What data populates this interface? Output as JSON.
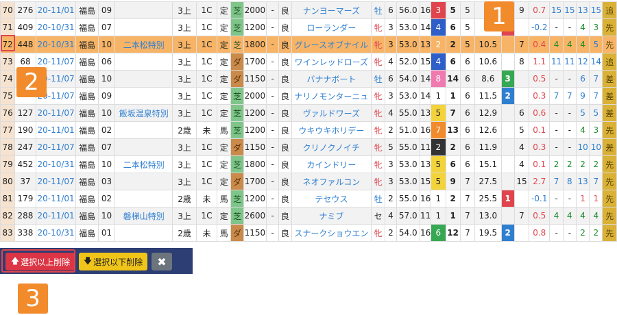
{
  "rows": [
    {
      "idx": "70",
      "id": "276",
      "date": "20-11/01",
      "venue": "福島",
      "vnum": "09",
      "race": "",
      "cls": "3上",
      "grade": "1C",
      "kind": "定",
      "surf": "芝",
      "dist": "2000",
      "dash": "-",
      "cond": "良",
      "horse": "ナンヨーマーズ",
      "sex": "牡",
      "age": "6",
      "wt": "56.0",
      "n": "16",
      "gate": "3",
      "pos": "5",
      "pop": "5",
      "odds": "",
      "rank": "",
      "rt": "9",
      "diff": "0.7",
      "c1": "15",
      "c2": "15",
      "c3": "13",
      "c4": "15",
      "style": "追"
    },
    {
      "idx": "71",
      "id": "409",
      "date": "20-10/31",
      "venue": "福島",
      "vnum": "07",
      "race": "",
      "cls": "3上",
      "grade": "1C",
      "kind": "定",
      "surf": "芝",
      "dist": "1200",
      "dash": "-",
      "cond": "良",
      "horse": "ローランダー",
      "sex": "牝",
      "age": "3",
      "wt": "53.0",
      "n": "14",
      "gate": "4",
      "pos": "6",
      "pop": "5",
      "odds": "",
      "rank": "1",
      "rt": "",
      "diff": "-0.2",
      "c1": "-",
      "c2": "-",
      "c3": "4",
      "c4": "3",
      "style": "先"
    },
    {
      "idx": "72",
      "id": "448",
      "date": "20-10/31",
      "venue": "福島",
      "vnum": "10",
      "race": "二本松特別",
      "cls": "3上",
      "grade": "1C",
      "kind": "定",
      "surf": "芝",
      "dist": "1800",
      "dash": "-",
      "cond": "良",
      "horse": "グレースオブナイル",
      "sex": "牝",
      "age": "3",
      "wt": "53.0",
      "n": "13",
      "gate": "2",
      "pos": "2",
      "pop": "5",
      "odds": "10.5",
      "rank": "",
      "rt": "7",
      "diff": "0.4",
      "c1": "4",
      "c2": "4",
      "c3": "4",
      "c4": "5",
      "style": "先"
    },
    {
      "idx": "73",
      "id": "68",
      "date": "20-11/07",
      "venue": "福島",
      "vnum": "06",
      "race": "",
      "cls": "3上",
      "grade": "1C",
      "kind": "定",
      "surf": "ダ",
      "dist": "1700",
      "dash": "-",
      "cond": "良",
      "horse": "ワインレッドローズ",
      "sex": "牝",
      "age": "4",
      "wt": "52.0",
      "n": "15",
      "gate": "4",
      "pos": "6",
      "pop": "6",
      "odds": "10.6",
      "rank": "",
      "rt": "8",
      "diff": "1.1",
      "c1": "11",
      "c2": "11",
      "c3": "12",
      "c4": "14",
      "style": "追"
    },
    {
      "idx": "74",
      "id": "",
      "date": "20-11/07",
      "venue": "福島",
      "vnum": "10",
      "race": "",
      "cls": "3上",
      "grade": "1C",
      "kind": "定",
      "surf": "ダ",
      "dist": "1150",
      "dash": "-",
      "cond": "良",
      "horse": "バナナボート",
      "sex": "牡",
      "age": "6",
      "wt": "54.0",
      "n": "14",
      "gate": "8",
      "pos": "14",
      "pop": "6",
      "odds": "8.6",
      "rank": "3",
      "rt": "",
      "diff": "0.5",
      "c1": "-",
      "c2": "-",
      "c3": "6",
      "c4": "7",
      "style": "差"
    },
    {
      "idx": "75",
      "id": "",
      "date": "20-11/07",
      "venue": "福島",
      "vnum": "09",
      "race": "",
      "cls": "3上",
      "grade": "1C",
      "kind": "定",
      "surf": "芝",
      "dist": "2000",
      "dash": "-",
      "cond": "良",
      "horse": "ナリノモンターニュ",
      "sex": "牝",
      "age": "3",
      "wt": "53.0",
      "n": "14",
      "gate": "1",
      "pos": "1",
      "pop": "6",
      "odds": "11.5",
      "rank": "2",
      "rt": "",
      "diff": "0.3",
      "c1": "7",
      "c2": "7",
      "c3": "9",
      "c4": "7",
      "style": "差"
    },
    {
      "idx": "76",
      "id": "127",
      "date": "20-11/07",
      "venue": "福島",
      "vnum": "10",
      "race": "飯坂温泉特別",
      "cls": "3上",
      "grade": "1C",
      "kind": "定",
      "surf": "芝",
      "dist": "1200",
      "dash": "-",
      "cond": "良",
      "horse": "ヴァルドワーズ",
      "sex": "牝",
      "age": "4",
      "wt": "55.0",
      "n": "13",
      "gate": "5",
      "pos": "7",
      "pop": "6",
      "odds": "12.9",
      "rank": "",
      "rt": "6",
      "diff": "0.6",
      "c1": "-",
      "c2": "-",
      "c3": "5",
      "c4": "5",
      "style": "差"
    },
    {
      "idx": "77",
      "id": "190",
      "date": "20-11/01",
      "venue": "福島",
      "vnum": "02",
      "race": "",
      "cls": "2歳",
      "grade": "未",
      "kind": "馬",
      "surf": "芝",
      "dist": "1200",
      "dash": "-",
      "cond": "良",
      "horse": "ウキウキホリデー",
      "sex": "牝",
      "age": "2",
      "wt": "51.0",
      "n": "16",
      "gate": "7",
      "pos": "13",
      "pop": "6",
      "odds": "12.6",
      "rank": "",
      "rt": "5",
      "diff": "0.1",
      "c1": "-",
      "c2": "-",
      "c3": "4",
      "c4": "3",
      "style": "先"
    },
    {
      "idx": "78",
      "id": "247",
      "date": "20-11/07",
      "venue": "福島",
      "vnum": "07",
      "race": "",
      "cls": "3上",
      "grade": "1C",
      "kind": "定",
      "surf": "ダ",
      "dist": "1150",
      "dash": "-",
      "cond": "良",
      "horse": "クリノクノイチ",
      "sex": "牝",
      "age": "5",
      "wt": "55.0",
      "n": "11",
      "gate": "2",
      "pos": "2",
      "pop": "6",
      "odds": "11.9",
      "rank": "",
      "rt": "4",
      "diff": "0.3",
      "c1": "-",
      "c2": "-",
      "c3": "10",
      "c4": "10",
      "style": "差"
    },
    {
      "idx": "79",
      "id": "452",
      "date": "20-10/31",
      "venue": "福島",
      "vnum": "10",
      "race": "二本松特別",
      "cls": "3上",
      "grade": "1C",
      "kind": "定",
      "surf": "芝",
      "dist": "1800",
      "dash": "-",
      "cond": "良",
      "horse": "カインドリー",
      "sex": "牝",
      "age": "3",
      "wt": "53.0",
      "n": "13",
      "gate": "5",
      "pos": "6",
      "pop": "6",
      "odds": "15.1",
      "rank": "",
      "rt": "4",
      "diff": "0.1",
      "c1": "2",
      "c2": "2",
      "c3": "2",
      "c4": "2",
      "style": "先"
    },
    {
      "idx": "80",
      "id": "37",
      "date": "20-11/07",
      "venue": "福島",
      "vnum": "03",
      "race": "",
      "cls": "3上",
      "grade": "1C",
      "kind": "定",
      "surf": "ダ",
      "dist": "1700",
      "dash": "-",
      "cond": "良",
      "horse": "ネオファルコン",
      "sex": "牝",
      "age": "3",
      "wt": "53.0",
      "n": "15",
      "gate": "5",
      "pos": "9",
      "pop": "7",
      "odds": "27.5",
      "rank": "",
      "rt": "15",
      "diff": "2.7",
      "c1": "7",
      "c2": "8",
      "c3": "13",
      "c4": "7",
      "style": "先"
    },
    {
      "idx": "81",
      "id": "179",
      "date": "20-11/01",
      "venue": "福島",
      "vnum": "02",
      "race": "",
      "cls": "2歳",
      "grade": "未",
      "kind": "馬",
      "surf": "芝",
      "dist": "1200",
      "dash": "-",
      "cond": "良",
      "horse": "テセウス",
      "sex": "牡",
      "age": "2",
      "wt": "55.0",
      "n": "16",
      "gate": "1",
      "pos": "2",
      "pop": "7",
      "odds": "25.5",
      "rank": "1",
      "rt": "",
      "diff": "-0.1",
      "c1": "-",
      "c2": "-",
      "c3": "1",
      "c4": "1",
      "style": "先"
    },
    {
      "idx": "82",
      "id": "288",
      "date": "20-11/01",
      "venue": "福島",
      "vnum": "10",
      "race": "磐梯山特別",
      "cls": "3上",
      "grade": "1C",
      "kind": "定",
      "surf": "芝",
      "dist": "2600",
      "dash": "-",
      "cond": "良",
      "horse": "ナミブ",
      "sex": "セ",
      "age": "4",
      "wt": "57.0",
      "n": "11",
      "gate": "1",
      "pos": "1",
      "pop": "7",
      "odds": "13.0",
      "rank": "",
      "rt": "7",
      "diff": "0.5",
      "c1": "4",
      "c2": "4",
      "c3": "4",
      "c4": "4",
      "style": "先"
    },
    {
      "idx": "83",
      "id": "338",
      "date": "20-10/31",
      "venue": "福島",
      "vnum": "01",
      "race": "",
      "cls": "2歳",
      "grade": "未",
      "kind": "馬",
      "surf": "ダ",
      "dist": "1150",
      "dash": "-",
      "cond": "良",
      "horse": "スナークショウエン",
      "sex": "牝",
      "age": "2",
      "wt": "54.0",
      "n": "16",
      "gate": "6",
      "pos": "12",
      "pop": "7",
      "odds": "19.5",
      "rank": "2",
      "rt": "",
      "diff": "0.8",
      "c1": "-",
      "c2": "-",
      "c3": "2",
      "c4": "2",
      "style": "先"
    }
  ],
  "toolbar": {
    "delete_above_label": "選択以上削除",
    "delete_below_label": "選択以下削除",
    "up_arrow": "🡅",
    "down_arrow": "🡇",
    "close_label": "✖"
  },
  "callouts": {
    "one": "1",
    "two": "2",
    "three": "3"
  },
  "colors": {
    "accent": "#f28b2c",
    "danger": "#dc3545",
    "warning": "#f0c419",
    "toolbar_bg": "#2c3e73",
    "selected_row": "#f7b467"
  }
}
